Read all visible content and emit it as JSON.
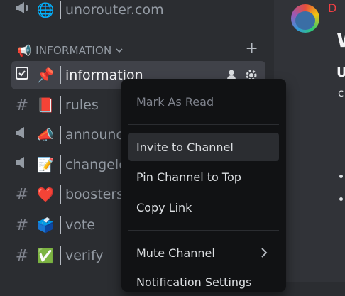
{
  "sidebar": {
    "top_channel": {
      "emoji": "📢",
      "emoji2": "🌐",
      "name": "unorouter.com"
    },
    "category": {
      "icon": "📢",
      "label": "INFORMATION",
      "chevron": "⌄",
      "add": "+"
    },
    "channels": [
      {
        "type": "rules-icon",
        "emoji": "📌",
        "name": "information",
        "selected": true
      },
      {
        "type": "#",
        "emoji": "📕",
        "name": "rules"
      },
      {
        "type": "announcement-icon",
        "emoji": "📣",
        "name": "announc"
      },
      {
        "type": "announcement-icon",
        "emoji": "📝",
        "name": "changelo"
      },
      {
        "type": "#",
        "emoji": "❤️",
        "name": "boosters"
      },
      {
        "type": "#",
        "emoji": "🗳️",
        "name": "vote"
      },
      {
        "type": "#",
        "emoji": "✅",
        "name": "verify"
      }
    ]
  },
  "chat": {
    "title_char": "W",
    "u_char": "U",
    "c_char": "c",
    "d_char": "D"
  },
  "context_menu": {
    "items": [
      {
        "label": "Mark As Read",
        "state": "disabled"
      },
      {
        "label": "Invite to Channel",
        "state": "hover"
      },
      {
        "label": "Pin Channel to Top",
        "state": "normal"
      },
      {
        "label": "Copy Link",
        "state": "normal"
      },
      {
        "label": "Mute Channel",
        "state": "submenu"
      },
      {
        "label": "Notification Settings",
        "state": "submenu"
      }
    ]
  },
  "colors": {
    "accent": "#f23f43",
    "selected_bg": "#404249",
    "menu_bg": "#111214"
  }
}
